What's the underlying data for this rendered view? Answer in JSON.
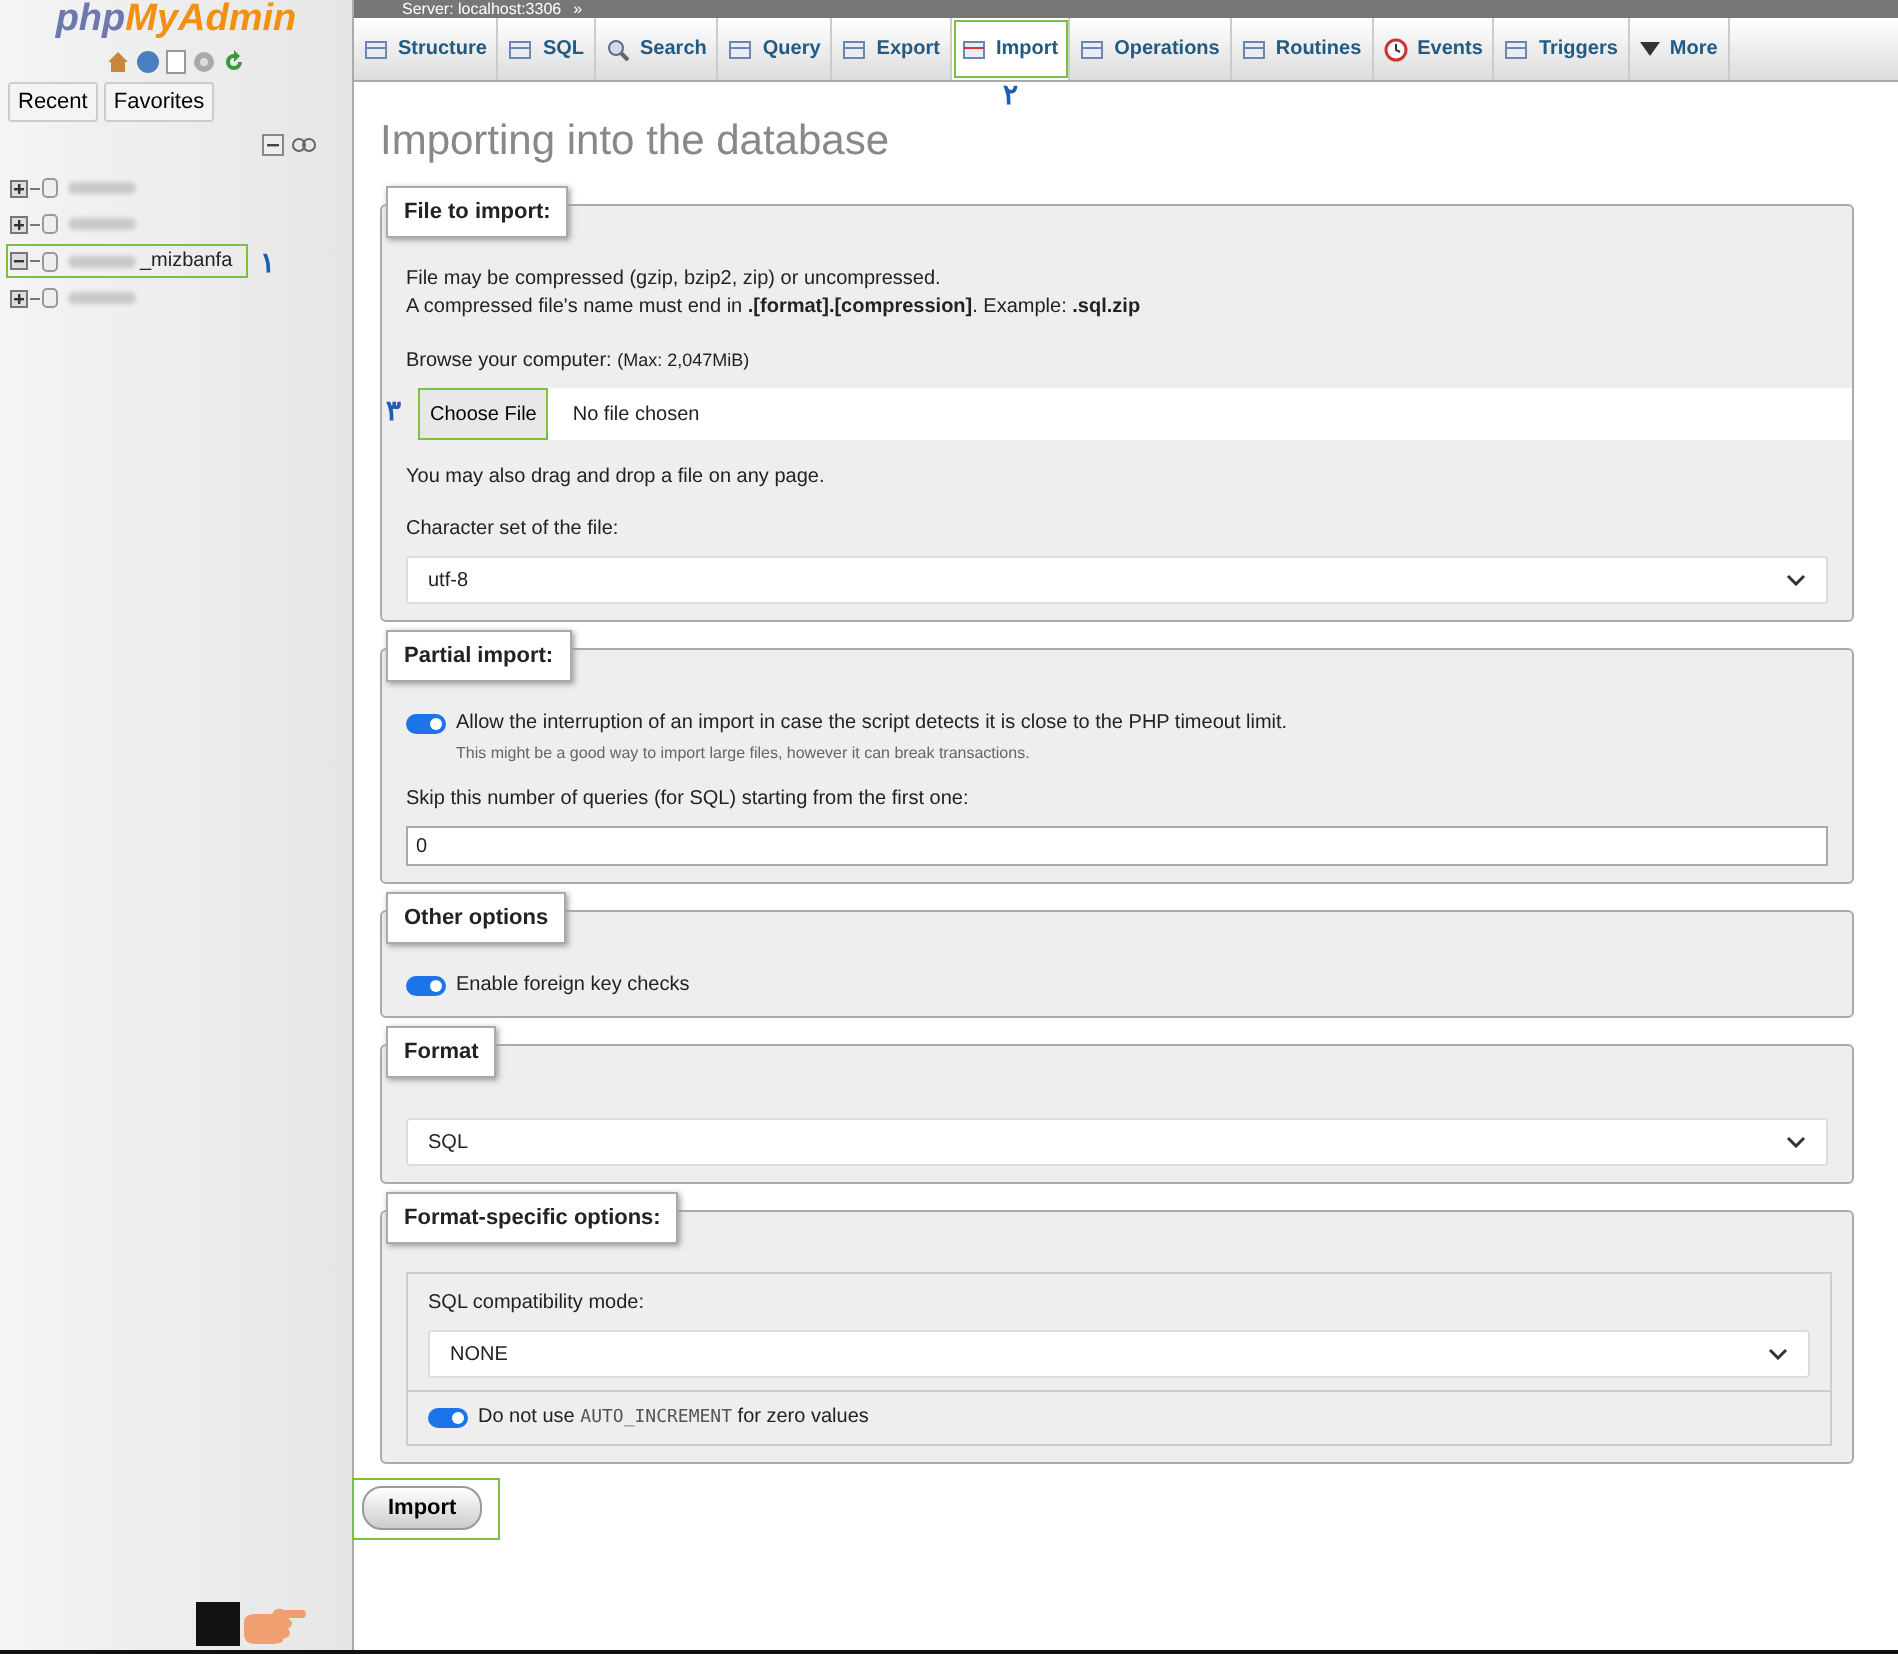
{
  "sidebar": {
    "logo": {
      "prefix": "php",
      "name": "MyAdmin"
    },
    "buttons": [
      {
        "label": "Recent"
      },
      {
        "label": "Favorites"
      }
    ],
    "tree": [
      {
        "expanded": false,
        "highlighted": false
      },
      {
        "expanded": false,
        "highlighted": false
      },
      {
        "expanded": true,
        "highlighted": true,
        "label": "_mizbanfa",
        "annotation": "۱"
      },
      {
        "expanded": false,
        "highlighted": false
      }
    ]
  },
  "breadcrumb": {
    "server": "Server: localhost:3306",
    "separator": "»"
  },
  "tabs": [
    {
      "label": "Structure",
      "selected": false,
      "highlighted": false
    },
    {
      "label": "SQL",
      "selected": false,
      "highlighted": false
    },
    {
      "label": "Search",
      "selected": false,
      "highlighted": false
    },
    {
      "label": "Query",
      "selected": false,
      "highlighted": false
    },
    {
      "label": "Export",
      "selected": false,
      "highlighted": false
    },
    {
      "label": "Import",
      "selected": true,
      "highlighted": true,
      "annotation": "۲"
    },
    {
      "label": "Operations",
      "selected": false,
      "highlighted": false
    },
    {
      "label": "Routines",
      "selected": false,
      "highlighted": false
    },
    {
      "label": "Events",
      "selected": false,
      "highlighted": false
    },
    {
      "label": "Triggers",
      "selected": false,
      "highlighted": false
    },
    {
      "label": "More",
      "selected": false,
      "highlighted": false
    }
  ],
  "page_title": "Importing into the database",
  "file_to_import": {
    "legend": "File to import:",
    "lines": [
      "File may be compressed (gzip, bzip2, zip) or uncompressed.",
      "A compressed file's name must end in **.[format].[compression]**. Example: **.sql.zip**"
    ],
    "browse_label": "Browse your computer:",
    "browse_max": "(Max: 2,047MiB)",
    "choose_button": {
      "label": "Choose File",
      "highlighted": true,
      "annotation": "۳"
    },
    "file_status": "No file chosen",
    "drag_note": "You may also drag and drop a file on any page.",
    "charset_label": "Character set of the file:",
    "charset_value": "utf-8"
  },
  "partial_import": {
    "legend": "Partial import:",
    "toggle": {
      "label": "Allow the interruption of an import in case the script detects it is close to the PHP timeout limit.",
      "on": true
    },
    "hint": "This might be a good way to import large files, however it can break transactions.",
    "skip_label": "Skip this number of queries (for SQL) starting from the first one:",
    "skip_value": "0"
  },
  "other_options": {
    "legend": "Other options",
    "toggle": {
      "label": "Enable foreign key checks",
      "on": true
    }
  },
  "format": {
    "legend": "Format",
    "value": "SQL"
  },
  "format_specific": {
    "legend": "Format-specific options:",
    "compat_label": "SQL compatibility mode:",
    "compat_value": "NONE",
    "toggle": {
      "before": "Do not use",
      "code": "AUTO_INCREMENT",
      "after": "for zero values",
      "on": true
    }
  },
  "import_button": {
    "label": "Import",
    "highlighted": true
  }
}
